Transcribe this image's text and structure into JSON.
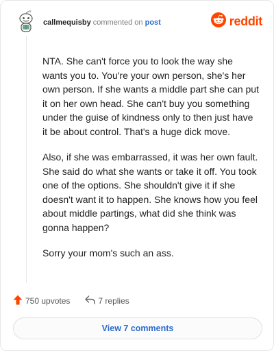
{
  "comment": {
    "username": "callmequisby",
    "action": "commented on",
    "target": "post",
    "paragraphs": [
      "NTA. She can't force you to look the way she wants you to. You're your own person, she's her own person. If she wants a middle part she can put it on her own head. She can't buy you something under the guise of kindness only to then just have it be about control. That's a huge dick move.",
      "Also, if she was embarrassed, it was her own fault. She said do what she wants or take it off. You took one of the options. She shouldn't give it if she doesn't want it to happen. She knows how you feel about middle partings, what did she think was gonna happen?",
      "Sorry your mom's such an ass."
    ],
    "upvotes_label": "750 upvotes",
    "replies_label": "7 replies"
  },
  "brand": {
    "name": "reddit",
    "color": "#ff4500"
  },
  "view_button_label": "View 7 comments",
  "icons": {
    "avatar": "snoo-avatar-icon",
    "logo": "reddit-logo-icon",
    "upvote": "upvote-arrow-icon",
    "reply": "reply-arrow-icon"
  },
  "colors": {
    "link": "#2a6bcf",
    "upvote": "#ff4500",
    "muted": "#7c7c7c"
  }
}
